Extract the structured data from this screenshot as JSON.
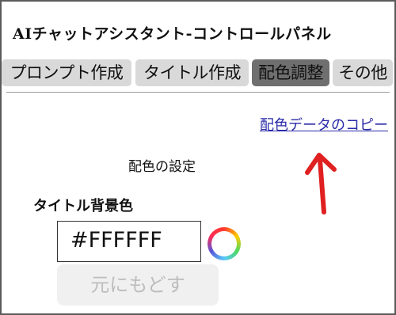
{
  "app": {
    "title": "AIチャットアシスタント-コントロールパネル"
  },
  "tabs": [
    {
      "label": "プロンプト作成",
      "active": false
    },
    {
      "label": "タイトル作成",
      "active": false
    },
    {
      "label": "配色調整",
      "active": true
    },
    {
      "label": "その他",
      "active": false
    }
  ],
  "colors_panel": {
    "copy_link": "配色データのコピー",
    "section_title": "配色の設定",
    "title_bg_label": "タイトル背景色",
    "title_bg_value": "#FFFFFF",
    "reset_label": "元にもどす"
  },
  "annotation": {
    "arrow_color": "#e02020"
  }
}
